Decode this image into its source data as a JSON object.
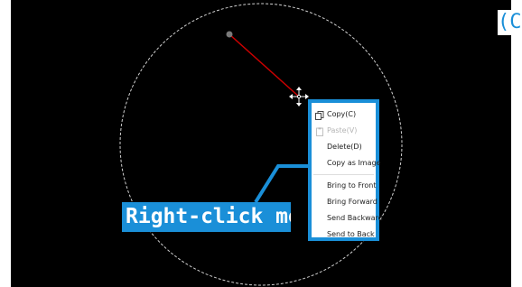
{
  "badge": {
    "text": "(C)"
  },
  "context_menu": {
    "items": [
      {
        "label": "Copy(C)",
        "icon": "copy-icon",
        "enabled": true
      },
      {
        "label": "Paste(V)",
        "icon": "paste-icon",
        "enabled": false
      },
      {
        "label": "Delete(D)",
        "enabled": true
      },
      {
        "label": "Copy as Image",
        "enabled": true
      },
      {
        "label": "Bring to Front",
        "enabled": true
      },
      {
        "label": "Bring Forward",
        "enabled": true
      },
      {
        "label": "Send Backward",
        "enabled": true
      },
      {
        "label": "Send to Back",
        "enabled": true
      }
    ]
  },
  "callout": {
    "text": "Right-click menu"
  },
  "colors": {
    "canvas_background": "#000000",
    "line_color": "#cc0000",
    "accent_blue": "#1a8fd8",
    "circle_color": "#cfcfcf"
  }
}
